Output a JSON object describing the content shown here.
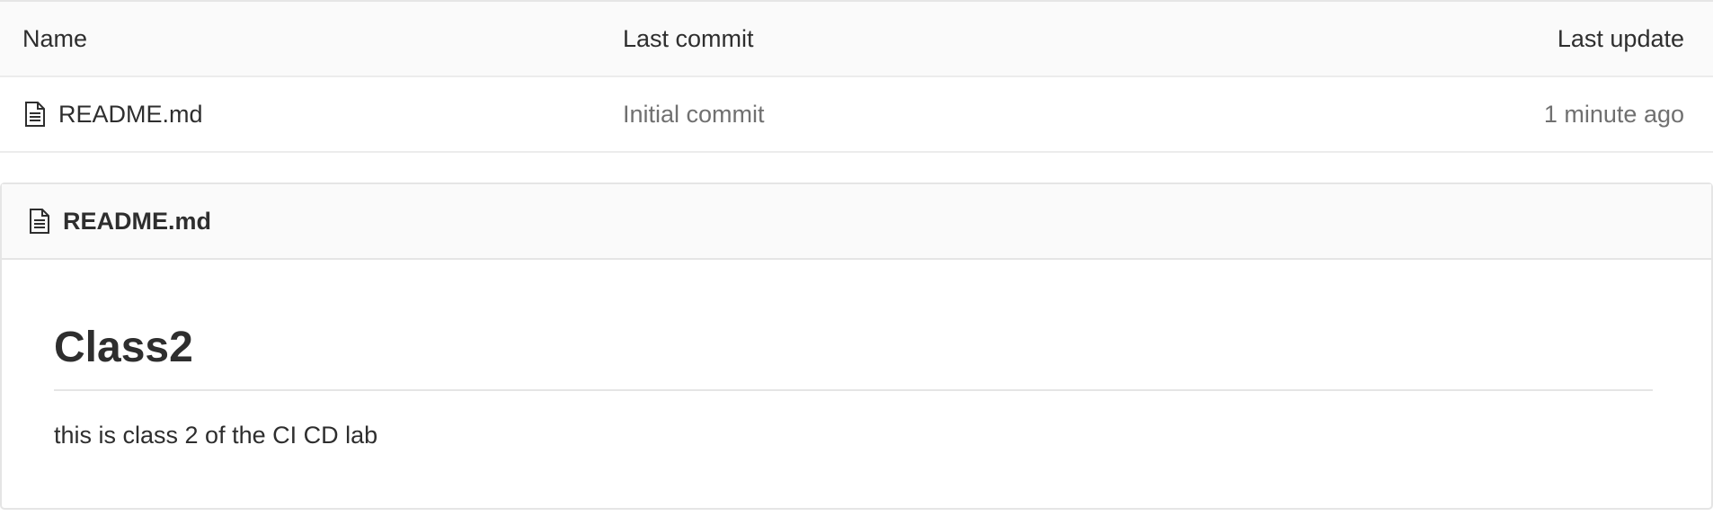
{
  "table": {
    "headers": {
      "name": "Name",
      "last_commit": "Last commit",
      "last_update": "Last update"
    },
    "rows": [
      {
        "icon": "file-text-icon",
        "name": "README.md",
        "commit_message": "Initial commit",
        "updated": "1 minute ago"
      }
    ]
  },
  "readme": {
    "icon": "file-text-icon",
    "filename": "README.md",
    "heading": "Class2",
    "paragraph": "this is class 2 of the CI CD lab"
  }
}
